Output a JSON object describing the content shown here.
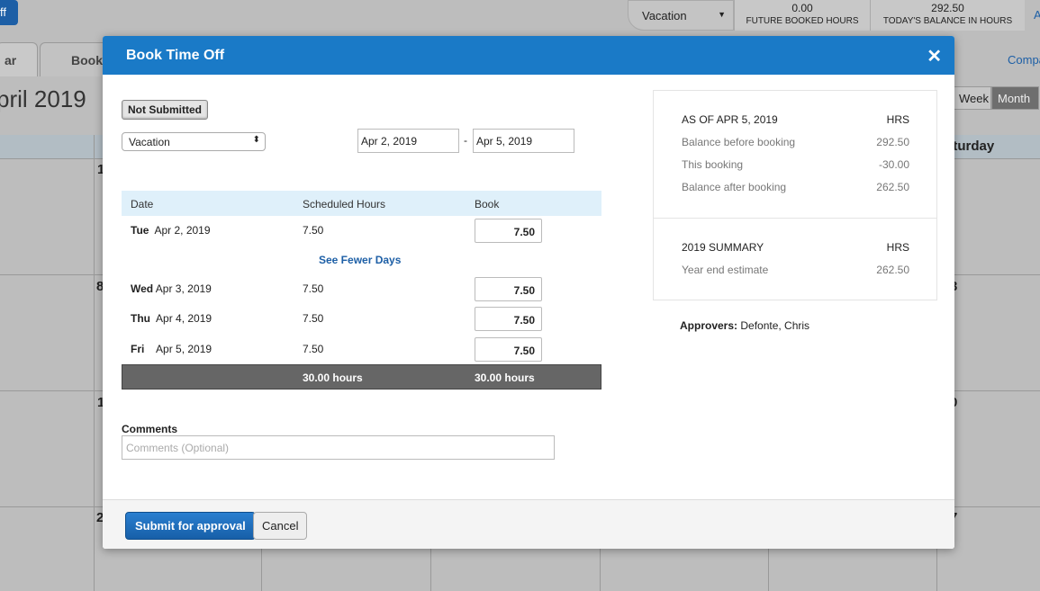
{
  "background": {
    "top_button": "ff",
    "leave_type": "Vacation",
    "future_booked_value": "0.00",
    "future_booked_label": "FUTURE BOOKED HOURS",
    "balance_value": "292.50",
    "balance_label": "TODAY'S BALANCE IN HOURS",
    "edge_link": "A",
    "tabs": [
      "ar",
      "Book"
    ],
    "month_title": "pril 2019",
    "company_link": "Compa",
    "view_buttons": [
      "Week",
      "Month"
    ],
    "saturday_header": "aturday",
    "left_day_numbers": [
      "1",
      "8",
      "1",
      "2"
    ],
    "right_day_numbers": [
      "3",
      "0",
      "7"
    ]
  },
  "modal": {
    "title": "Book Time Off",
    "close_icon": "close-x",
    "status_badge": "Not Submitted",
    "leave_type": "Vacation",
    "start_date": "Apr 2, 2019",
    "date_separator": "-",
    "end_date": "Apr 5, 2019",
    "table": {
      "headers": [
        "Date",
        "Scheduled Hours",
        "Book"
      ],
      "rows": [
        {
          "day": "Tue",
          "date": "Apr 2, 2019",
          "scheduled": "7.50",
          "book": "7.50"
        },
        {
          "day": "Wed",
          "date": "Apr 3, 2019",
          "scheduled": "7.50",
          "book": "7.50"
        },
        {
          "day": "Thu",
          "date": "Apr 4, 2019",
          "scheduled": "7.50",
          "book": "7.50"
        },
        {
          "day": "Fri",
          "date": "Apr 5, 2019",
          "scheduled": "7.50",
          "book": "7.50"
        }
      ],
      "see_fewer_link": "See Fewer Days",
      "total_scheduled": "30.00 hours",
      "total_book": "30.00 hours"
    },
    "comments_label": "Comments",
    "comments_placeholder": "Comments (Optional)",
    "summary": {
      "as_of_label": "AS OF APR 5, 2019",
      "hrs": "HRS",
      "balance_before_label": "Balance before booking",
      "balance_before": "292.50",
      "this_booking_label": "This booking",
      "this_booking": "-30.00",
      "balance_after_label": "Balance after booking",
      "balance_after": "262.50",
      "year_summary_label": "2019 SUMMARY",
      "year_end_label": "Year end estimate",
      "year_end": "262.50"
    },
    "approvers_label": "Approvers:",
    "approvers": "Defonte, Chris",
    "submit_button": "Submit for approval",
    "cancel_button": "Cancel"
  },
  "colors": {
    "header_blue": "#1a7ac7",
    "link_blue": "#1d5fa6",
    "table_header": "#dff0fa",
    "total_row": "#666666"
  }
}
